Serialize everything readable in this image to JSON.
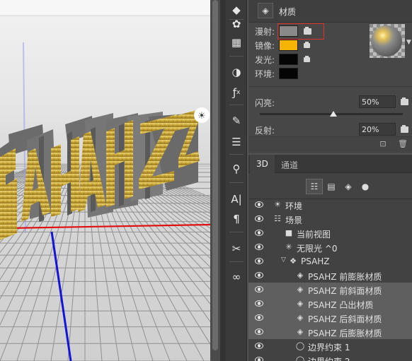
{
  "properties_panel": {
    "header_title": "材质",
    "material_rows": [
      {
        "label": "漫射:",
        "color": "#898989"
      },
      {
        "label": "镜像:",
        "color": "#f5b200"
      },
      {
        "label": "发光:",
        "color": "#050505"
      },
      {
        "label": "环境:",
        "color": "#050505"
      }
    ],
    "shine_label": "闪亮:",
    "shine_value": "50%",
    "reflect_label": "反射:",
    "reflect_value": "20%"
  },
  "panel_3d": {
    "tabs": [
      {
        "label": "3D",
        "active": true
      },
      {
        "label": "通道",
        "active": false
      }
    ],
    "filters": [
      "scene-filter-icon",
      "mesh-filter-icon",
      "material-filter-icon",
      "light-filter-icon"
    ],
    "layers": [
      {
        "label": "环境",
        "icon": "environment-icon",
        "selected": false
      },
      {
        "label": "场景",
        "icon": "scene-icon",
        "selected": false
      },
      {
        "label": "当前视图",
        "icon": "camera-icon",
        "selected": false
      },
      {
        "label": "无限光 ^0",
        "icon": "infinite-light-icon",
        "selected": false
      },
      {
        "label": "PSAHZ",
        "icon": "mesh-icon",
        "selected": false
      },
      {
        "label": "PSAHZ 前膨胀材质",
        "icon": "material-icon",
        "selected": false
      },
      {
        "label": "PSAHZ 前斜面材质",
        "icon": "material-icon",
        "selected": true
      },
      {
        "label": "PSAHZ 凸出材质",
        "icon": "material-icon",
        "selected": true
      },
      {
        "label": "PSAHZ 后斜面材质",
        "icon": "material-icon",
        "selected": true
      },
      {
        "label": "PSAHZ 后膨胀材质",
        "icon": "material-icon",
        "selected": true
      },
      {
        "label": "边界约束 1",
        "icon": "constraint-icon",
        "selected": false
      },
      {
        "label": "边界约束 2",
        "icon": "constraint-icon",
        "selected": false
      }
    ]
  },
  "viewport": {
    "scene_text": "PSAHZ",
    "colors": {
      "grid": "#8a8a8a",
      "x_axis": "#e01010",
      "z_axis": "#1414d6",
      "y_axis": "#9a9af0",
      "gold": "#c9a83a",
      "extrusion": "#707070"
    }
  },
  "toolbar_icons": [
    "3d-panel-icon",
    "grid-icon",
    "adjustments-icon",
    "fx-icon",
    "brush-settings-icon",
    "brush-icon",
    "slider-icon",
    "character-panel-icon",
    "text-icon",
    "paragraph-icon",
    "tools-icon",
    "cc-libraries-icon"
  ]
}
